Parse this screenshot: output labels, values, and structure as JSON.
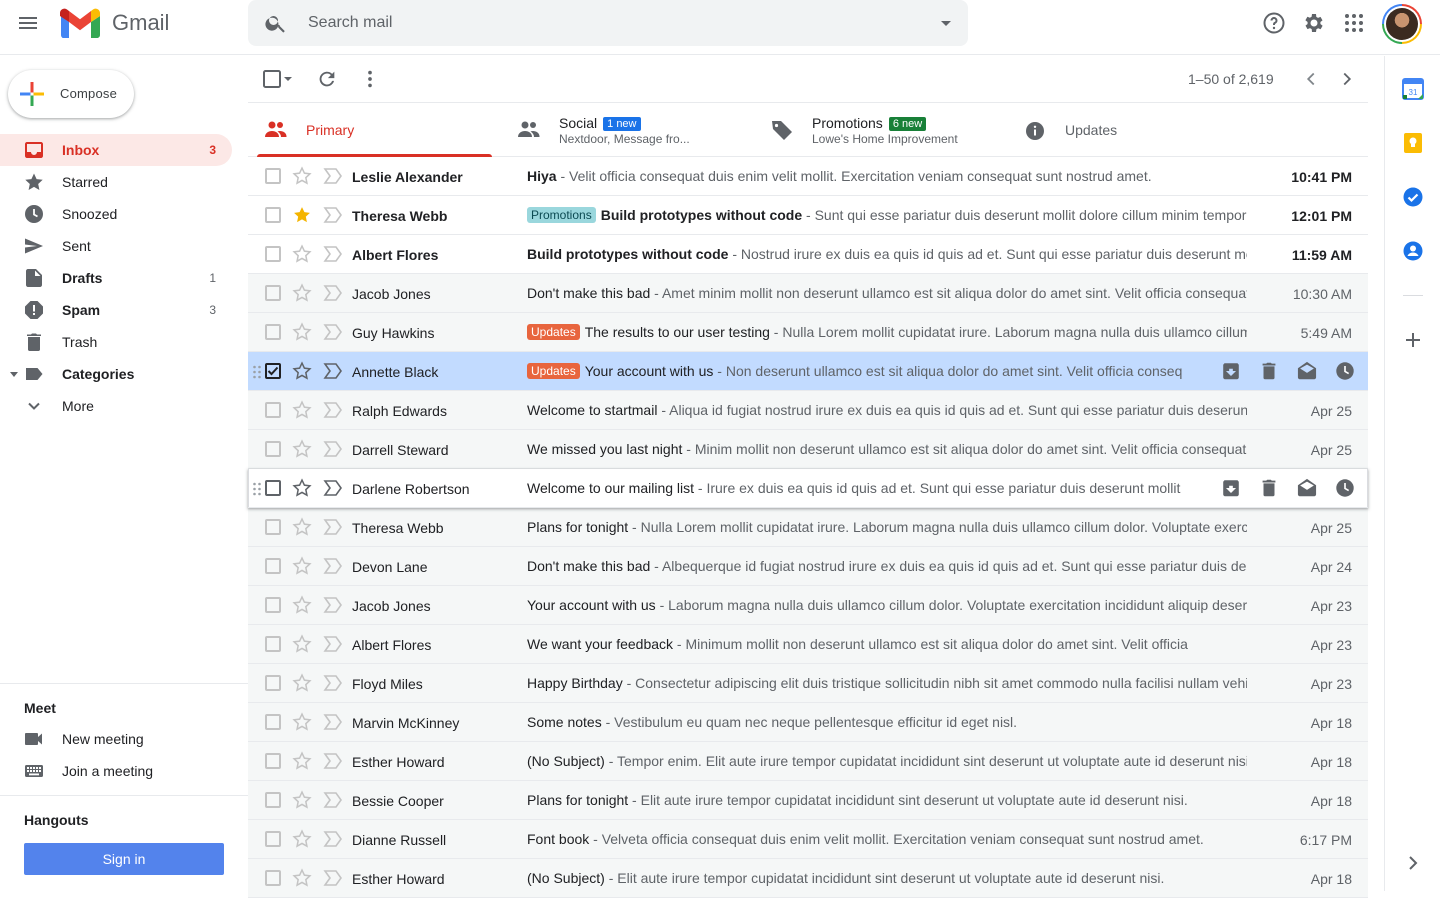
{
  "app": {
    "name": "Gmail"
  },
  "header": {
    "search_placeholder": "Search mail",
    "icons": [
      "menu-icon",
      "gmail-logo",
      "search-icon",
      "dropdown-icon",
      "help-icon",
      "settings-icon",
      "apps-icon",
      "avatar"
    ]
  },
  "compose": {
    "label": "Compose"
  },
  "nav": [
    {
      "label": "Inbox",
      "count": "3",
      "icon": "inbox-icon",
      "active": true,
      "bold": true
    },
    {
      "label": "Starred",
      "count": "",
      "icon": "star-icon",
      "active": false,
      "bold": false
    },
    {
      "label": "Snoozed",
      "count": "",
      "icon": "clock-icon",
      "active": false,
      "bold": false
    },
    {
      "label": "Sent",
      "count": "",
      "icon": "send-icon",
      "active": false,
      "bold": false
    },
    {
      "label": "Drafts",
      "count": "1",
      "icon": "draft-icon",
      "active": false,
      "bold": true
    },
    {
      "label": "Spam",
      "count": "3",
      "icon": "spam-icon",
      "active": false,
      "bold": true
    },
    {
      "label": "Trash",
      "count": "",
      "icon": "trash-icon",
      "active": false,
      "bold": false
    },
    {
      "label": "Categories",
      "count": "",
      "icon": "label-icon",
      "active": false,
      "bold": true
    },
    {
      "label": "More",
      "count": "",
      "icon": "chevron-down-icon",
      "active": false,
      "bold": false
    }
  ],
  "meet": {
    "title": "Meet",
    "new_meeting": "New meeting",
    "join_meeting": "Join a meeting"
  },
  "hangouts": {
    "title": "Hangouts",
    "signin": "Sign in"
  },
  "toolbar": {
    "pager": "1–50 of 2,619"
  },
  "tabs": {
    "primary": {
      "label": "Primary"
    },
    "social": {
      "label": "Social",
      "badge": "1 new",
      "sub": "Nextdoor, Message fro..."
    },
    "promotions": {
      "label": "Promotions",
      "badge": "6 new",
      "sub": "Lowe's Home Improvement"
    },
    "updates": {
      "label": "Updates"
    }
  },
  "colors": {
    "accent": "#d93025",
    "social_badge": "#1a73e8",
    "promo_badge": "#188038",
    "selected_row": "#c2dbff",
    "star": "#f4b400"
  },
  "emails": [
    {
      "sender": "Leslie Alexander",
      "label": "",
      "subject": "Hiya",
      "snippet": " - Velit officia consequat duis enim velit mollit. Exercitation veniam consequat sunt nostrud amet.",
      "date": "10:41 PM",
      "unread": true,
      "starred": false
    },
    {
      "sender": "Theresa Webb",
      "label": "Promotions",
      "subject": "Build prototypes without code",
      "snippet": " - Sunt qui esse pariatur duis deserunt mollit dolore cillum minim tempor enim.",
      "date": "12:01 PM",
      "unread": true,
      "starred": true
    },
    {
      "sender": "Albert Flores",
      "label": "",
      "subject": "Build prototypes without code",
      "snippet": " - Nostrud irure ex duis ea quis id quis ad et. Sunt qui esse pariatur duis deserunt mollit dolore.",
      "date": "11:59 AM",
      "unread": true,
      "starred": false
    },
    {
      "sender": "Jacob Jones",
      "label": "",
      "subject": "Don't make this bad",
      "snippet": " - Amet minim mollit non deserunt ullamco est sit aliqua dolor do amet sint. Velit officia consequat duis.",
      "date": "10:30 AM",
      "unread": false,
      "starred": false
    },
    {
      "sender": "Guy Hawkins",
      "label": "Updates",
      "subject": "The results to our user testing",
      "snippet": " - Nulla Lorem mollit cupidatat irure. Laborum magna nulla duis ullamco cillum dolor.",
      "date": "5:49 AM",
      "unread": false,
      "starred": false
    },
    {
      "sender": "Annette Black",
      "label": "Updates",
      "subject": "Your account with us",
      "snippet": " - Non deserunt ullamco est sit aliqua dolor do amet sint. Velit officia consequat duis enim.",
      "date": "",
      "unread": false,
      "starred": false,
      "selected": true
    },
    {
      "sender": "Ralph Edwards",
      "label": "",
      "subject": "Welcome to startmail",
      "snippet": " - Aliqua id fugiat nostrud irure ex duis ea quis id quis ad et. Sunt qui esse pariatur duis deserunt.",
      "date": "Apr 25",
      "unread": false,
      "starred": false
    },
    {
      "sender": "Darrell Steward",
      "label": "",
      "subject": "We missed you last night",
      "snippet": " - Minim mollit non deserunt ullamco est sit aliqua dolor do amet sint. Velit officia consequat.",
      "date": "Apr 25",
      "unread": false,
      "starred": false
    },
    {
      "sender": "Darlene Robertson",
      "label": "",
      "subject": "Welcome to our mailing list",
      "snippet": " - Irure ex duis ea quis id quis ad et. Sunt qui esse pariatur duis deserunt mollit dolore.",
      "date": "",
      "unread": false,
      "starred": false,
      "hover": true
    },
    {
      "sender": "Theresa Webb",
      "label": "",
      "subject": "Plans for tonight",
      "snippet": " - Nulla Lorem mollit cupidatat irure. Laborum magna nulla duis ullamco cillum dolor. Voluptate exercitation.",
      "date": "Apr 25",
      "unread": false,
      "starred": false
    },
    {
      "sender": "Devon Lane",
      "label": "",
      "subject": "Don't make this bad",
      "snippet": " - Albequerque id fugiat nostrud irure ex duis ea quis id quis ad et. Sunt qui esse pariatur duis deserunt.",
      "date": "Apr 24",
      "unread": false,
      "starred": false
    },
    {
      "sender": "Jacob Jones",
      "label": "",
      "subject": "Your account with us",
      "snippet": " - Laborum magna nulla duis ullamco cillum dolor. Voluptate exercitation incididunt aliquip deserunt.",
      "date": "Apr 23",
      "unread": false,
      "starred": false
    },
    {
      "sender": "Albert Flores",
      "label": "",
      "subject": "We want your feedback",
      "snippet": " - Minimum mollit non deserunt ullamco est sit aliqua dolor do amet sint. Velit officia",
      "date": "Apr 23",
      "unread": false,
      "starred": false
    },
    {
      "sender": "Floyd Miles",
      "label": "",
      "subject": "Happy Birthday",
      "snippet": " - Consectetur adipiscing elit duis tristique sollicitudin nibh sit amet commodo nulla facilisi nullam vehicula.",
      "date": "Apr 23",
      "unread": false,
      "starred": false
    },
    {
      "sender": "Marvin McKinney",
      "label": "",
      "subject": "Some notes",
      "snippet": " - Vestibulum eu quam nec neque pellentesque efficitur id eget nisl.",
      "date": "Apr 18",
      "unread": false,
      "starred": false
    },
    {
      "sender": "Esther Howard",
      "label": "",
      "subject": "(No Subject)",
      "snippet": " - Tempor enim. Elit aute irure tempor cupidatat incididunt sint deserunt ut voluptate aute id deserunt nisi.",
      "date": "Apr 18",
      "unread": false,
      "starred": false
    },
    {
      "sender": "Bessie Cooper",
      "label": "",
      "subject": "Plans for tonight",
      "snippet": " - Elit aute irure tempor cupidatat incididunt sint deserunt ut voluptate aute id deserunt nisi.",
      "date": "Apr 18",
      "unread": false,
      "starred": false
    },
    {
      "sender": "Dianne Russell",
      "label": "",
      "subject": "Font book",
      "snippet": " - Velveta officia consequat duis enim velit mollit. Exercitation veniam consequat sunt nostrud amet.",
      "date": "6:17 PM",
      "unread": false,
      "starred": false
    },
    {
      "sender": "Esther Howard",
      "label": "",
      "subject": "(No Subject)",
      "snippet": " - Elit aute irure tempor cupidatat incididunt sint deserunt ut voluptate aute id deserunt nisi.",
      "date": "Apr 18",
      "unread": false,
      "starred": false
    }
  ]
}
